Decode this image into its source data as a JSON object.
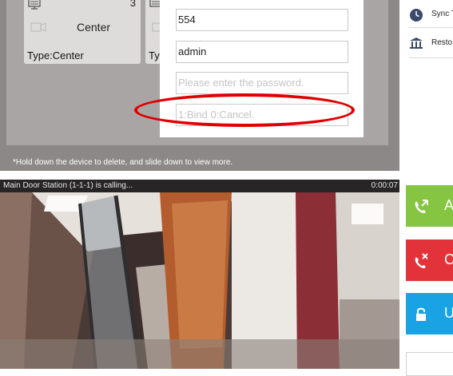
{
  "device_cards": [
    {
      "number": "3",
      "name": "Center",
      "type": "Type:Center"
    },
    {
      "type": "Typ"
    }
  ],
  "dialog": {
    "port_value": "554",
    "username_value": "admin",
    "password_placeholder": "Please enter the password.",
    "bind_placeholder": "1:Bind 0:Cancel."
  },
  "hint_text": "*Hold down the device to delete, and slide down to view more.",
  "settings": {
    "sync_label": "Sync T",
    "restore_label": "Resto"
  },
  "call": {
    "caller_text": "Main Door Station (1-1-1) is calling...",
    "timer": "0:00:07"
  },
  "actions": {
    "answer_label": "A",
    "cancel_label": "C",
    "unlock_label": "U"
  },
  "colors": {
    "answer": "#86c541",
    "cancel": "#e2333b",
    "unlock": "#19a3e4",
    "highlight_ellipse": "#e00000"
  }
}
